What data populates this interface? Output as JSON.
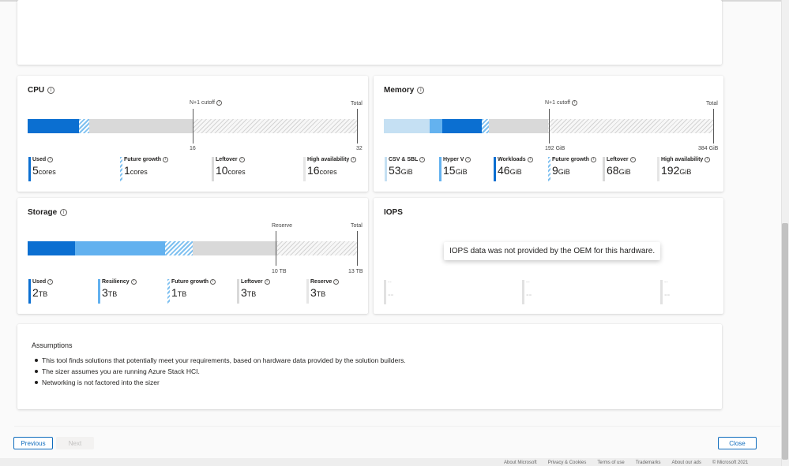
{
  "cpu": {
    "title": "CPU",
    "markers": {
      "cutoff_label": "N+1 cutoff",
      "total_label": "Total",
      "cutoff_value": "16",
      "total_value": "32"
    },
    "segments": [
      {
        "name": "Used",
        "fraction": 0.156,
        "color": "#0b6fd1"
      },
      {
        "name": "Future growth",
        "fraction": 0.031,
        "color": "hatch-blue"
      },
      {
        "name": "Leftover",
        "fraction": 0.313,
        "color": "#d9d9d9"
      },
      {
        "name": "High availability",
        "fraction": 0.5,
        "color": "hatch-grey"
      }
    ],
    "legend": [
      {
        "label": "Used",
        "value": "5",
        "unit": "cores"
      },
      {
        "label": "Future growth",
        "value": "1",
        "unit": "cores"
      },
      {
        "label": "Leftover",
        "value": "10",
        "unit": "cores"
      },
      {
        "label": "High availability",
        "value": "16",
        "unit": "cores"
      }
    ]
  },
  "memory": {
    "title": "Memory",
    "markers": {
      "cutoff_label": "N+1 cutoff",
      "total_label": "Total",
      "cutoff_value": "192 GiB",
      "total_value": "384 GiB"
    },
    "segments": [
      {
        "name": "CSV & SBL",
        "fraction": 0.138,
        "color": "#c5e0f3"
      },
      {
        "name": "Hyper V",
        "fraction": 0.039,
        "color": "#64b2ef"
      },
      {
        "name": "Workloads",
        "fraction": 0.12,
        "color": "#0b6fd1"
      },
      {
        "name": "Future growth",
        "fraction": 0.023,
        "color": "hatch-blue"
      },
      {
        "name": "Leftover",
        "fraction": 0.18,
        "color": "#d9d9d9"
      },
      {
        "name": "High availability",
        "fraction": 0.5,
        "color": "hatch-grey"
      }
    ],
    "legend": [
      {
        "label": "CSV & SBL",
        "value": "53",
        "unit": "GiB"
      },
      {
        "label": "Hyper V",
        "value": "15",
        "unit": "GiB"
      },
      {
        "label": "Workloads",
        "value": "46",
        "unit": "GiB"
      },
      {
        "label": "Future growth",
        "value": "9",
        "unit": "GiB"
      },
      {
        "label": "Leftover",
        "value": "68",
        "unit": "GiB"
      },
      {
        "label": "High availability",
        "value": "192",
        "unit": "GiB"
      }
    ]
  },
  "storage": {
    "title": "Storage",
    "markers": {
      "reserve_label": "Reserve",
      "total_label": "Total",
      "reserve_value": "10 TB",
      "total_value": "13 TB"
    },
    "segments": [
      {
        "name": "Used",
        "fraction": 0.143,
        "color": "#0b6fd1"
      },
      {
        "name": "Resiliency",
        "fraction": 0.273,
        "color": "#62b1ef"
      },
      {
        "name": "Future growth",
        "fraction": 0.084,
        "color": "hatch-blue"
      },
      {
        "name": "Leftover",
        "fraction": 0.255,
        "color": "#d9d9d9"
      },
      {
        "name": "Reserve",
        "fraction": 0.245,
        "color": "hatch-grey"
      }
    ],
    "legend": [
      {
        "label": "Used",
        "value": "2",
        "unit": "TB"
      },
      {
        "label": "Resiliency",
        "value": "3",
        "unit": "TB"
      },
      {
        "label": "Future growth",
        "value": "1",
        "unit": "TB"
      },
      {
        "label": "Leftover",
        "value": "3",
        "unit": "TB"
      },
      {
        "label": "Reserve",
        "value": "3",
        "unit": "TB"
      }
    ]
  },
  "iops": {
    "title": "IOPS",
    "tooltip": "IOPS data was not provided by the OEM for this hardware.",
    "placeholders": [
      {
        "label": "--",
        "value": "--"
      },
      {
        "label": "--",
        "value": "--"
      },
      {
        "label": "--",
        "value": "--"
      }
    ]
  },
  "assumptions": {
    "title": "Assumptions",
    "items": [
      "This tool finds solutions that potentially meet your requirements, based on hardware data provided by the solution builders.",
      "The sizer assumes you are running Azure Stack HCI.",
      "Networking is not factored into the sizer"
    ]
  },
  "buttons": {
    "previous": "Previous",
    "next": "Next",
    "close": "Close"
  },
  "footer": {
    "links": [
      "About Microsoft",
      "Privacy & Cookies",
      "Terms of use",
      "Trademarks",
      "About our ads",
      "© Microsoft 2021"
    ]
  },
  "colors": {
    "accent": "#0f6cbd",
    "used": "#0b6fd1",
    "light_blue": "#62b1ef",
    "leftover": "#d9d9d9"
  }
}
